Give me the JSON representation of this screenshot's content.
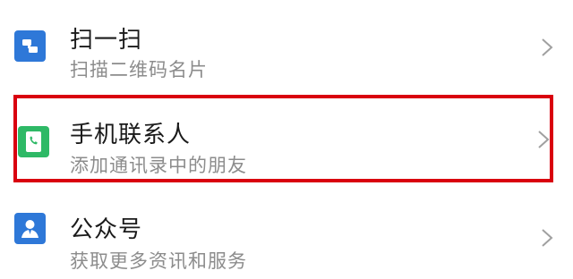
{
  "menu": {
    "items": [
      {
        "title": "扫一扫",
        "subtitle": "扫描二维码名片",
        "icon": "scan-icon"
      },
      {
        "title": "手机联系人",
        "subtitle": "添加通讯录中的朋友",
        "icon": "phone-contacts-icon",
        "highlighted": true
      },
      {
        "title": "公众号",
        "subtitle": "获取更多资讯和服务",
        "icon": "official-account-icon"
      }
    ]
  },
  "colors": {
    "highlight_border": "#d9000f",
    "blue_icon": "#2e78d8",
    "green_icon": "#2eb966",
    "title_text": "#1a1a1a",
    "subtitle_text": "#8c8c8c"
  }
}
